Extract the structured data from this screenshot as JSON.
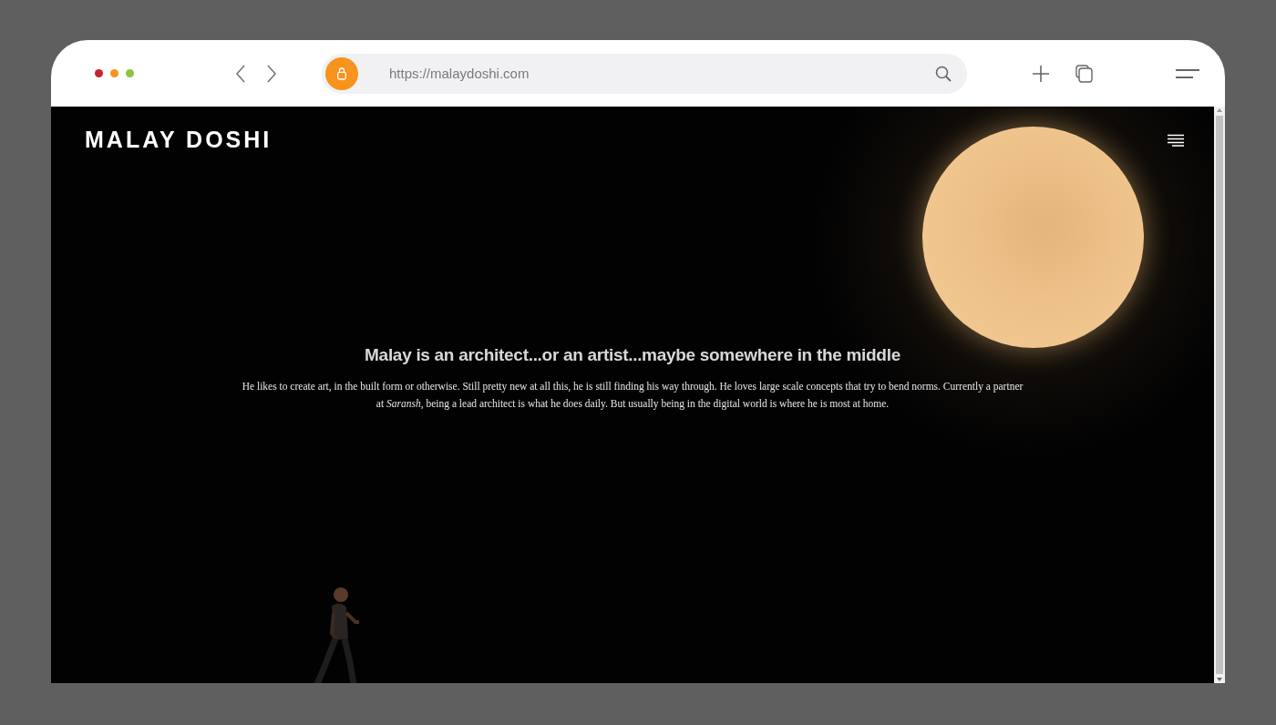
{
  "browser": {
    "url": "https://malaydoshi.com"
  },
  "site": {
    "logo": "MALAY DOSHI",
    "headline": "Malay is an architect...or an artist...maybe somewhere in the middle",
    "paragraph": "He likes to create art, in the built form or otherwise. Still pretty new at all this, he is still finding his way through. He loves large scale concepts that try to bend norms. Currently a partner at *Saransh*, being a lead architect is what he does daily. But usually being in the digital world is where he is most at home."
  }
}
